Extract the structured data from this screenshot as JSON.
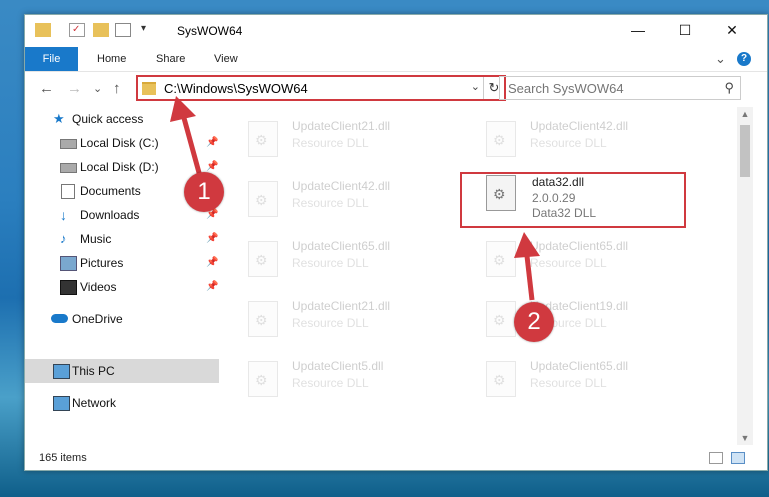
{
  "window": {
    "title": "SysWOW64",
    "controls": {
      "minimize": "—",
      "maximize": "☐",
      "close": "✕"
    }
  },
  "ribbon": {
    "tabs": [
      "File",
      "Home",
      "Share",
      "View"
    ],
    "expand": "⌄",
    "help": "?"
  },
  "nav": {
    "back": "←",
    "forward": "→",
    "recent": "⌄",
    "up": "↑",
    "address": "C:\\Windows\\SysWOW64",
    "search_placeholder": "Search SysWOW64"
  },
  "sidebar": {
    "items": [
      {
        "label": "Quick access",
        "icon": "star-icon"
      },
      {
        "label": "Local Disk (C:)",
        "icon": "drive-icon",
        "pinned": true
      },
      {
        "label": "Local Disk (D:)",
        "icon": "drive-icon",
        "pinned": true
      },
      {
        "label": "Documents",
        "icon": "documents-icon",
        "pinned": true
      },
      {
        "label": "Downloads",
        "icon": "downloads-icon",
        "pinned": true
      },
      {
        "label": "Music",
        "icon": "music-icon",
        "pinned": true
      },
      {
        "label": "Pictures",
        "icon": "pictures-icon",
        "pinned": true
      },
      {
        "label": "Videos",
        "icon": "videos-icon",
        "pinned": true
      },
      {
        "label": "OneDrive",
        "icon": "cloud-icon"
      },
      {
        "label": "This PC",
        "icon": "computer-icon",
        "selected": true
      },
      {
        "label": "Network",
        "icon": "network-icon"
      }
    ]
  },
  "files": [
    {
      "name": "UpdateClient21.dll",
      "type": "Resource DLL"
    },
    {
      "name": "UpdateClient42.dll",
      "type": "Resource DLL"
    },
    {
      "name": "UpdateClient42.dll",
      "type": "Resource DLL"
    },
    {
      "name": "data32.dll",
      "version": "2.0.0.29",
      "type": "Data32 DLL",
      "highlighted": true
    },
    {
      "name": "UpdateClient65.dll",
      "type": "Resource DLL"
    },
    {
      "name": "UpdateClient65.dll",
      "type": "Resource DLL"
    },
    {
      "name": "UpdateClient21.dll",
      "type": "Resource DLL"
    },
    {
      "name": "UpdateClient19.dll",
      "type": "Resource DLL"
    },
    {
      "name": "UpdateClient5.dll",
      "type": "Resource DLL"
    },
    {
      "name": "UpdateClient65.dll",
      "type": "Resource DLL"
    }
  ],
  "status": {
    "item_count": "165 items"
  },
  "annotations": {
    "step1": "1",
    "step2": "2"
  },
  "colors": {
    "accent": "#1979ca",
    "highlight": "#d0393f"
  }
}
